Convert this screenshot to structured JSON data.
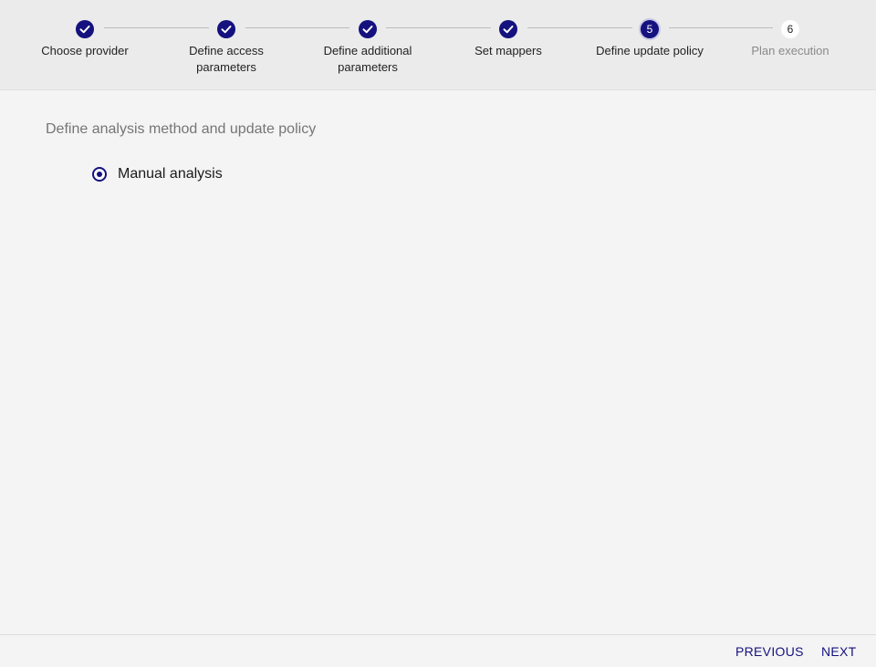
{
  "stepper": {
    "steps": [
      {
        "number": "1",
        "label_line1": "Choose provider",
        "label_line2": "",
        "state": "completed"
      },
      {
        "number": "2",
        "label_line1": "Define access",
        "label_line2": "parameters",
        "state": "completed"
      },
      {
        "number": "3",
        "label_line1": "Define additional",
        "label_line2": "parameters",
        "state": "completed"
      },
      {
        "number": "4",
        "label_line1": "Set mappers",
        "label_line2": "",
        "state": "completed"
      },
      {
        "number": "5",
        "label_line1": "Define update policy",
        "label_line2": "",
        "state": "active"
      },
      {
        "number": "6",
        "label_line1": "Plan execution",
        "label_line2": "",
        "state": "inactive"
      }
    ]
  },
  "main": {
    "section_title": "Define analysis method and update policy",
    "radio_option": {
      "label": "Manual analysis",
      "selected": true
    }
  },
  "footer": {
    "previous_label": "PREVIOUS",
    "next_label": "NEXT"
  },
  "colors": {
    "accent": "#15117e",
    "header_bg": "#ebebeb",
    "page_bg": "#f4f4f4"
  }
}
